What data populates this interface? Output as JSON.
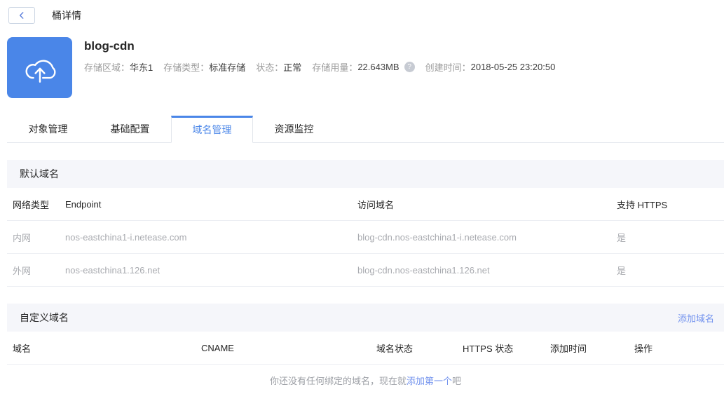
{
  "page": {
    "title": "桶详情"
  },
  "icons": {
    "help": "?"
  },
  "colors": {
    "accent": "#4a86e8",
    "link": "#7393ee",
    "icon_bg": "#4a86e8",
    "section_bar_bg": "#f5f6fa"
  },
  "bucket": {
    "name": "blog-cdn",
    "meta": [
      {
        "label": "存储区域：",
        "value": "华东1"
      },
      {
        "label": "存储类型：",
        "value": "标准存储"
      },
      {
        "label": "状态：",
        "value": "正常"
      },
      {
        "label": "存储用量：",
        "value": "22.643MB"
      },
      {
        "label": "创建时间：",
        "value": "2018-05-25 23:20:50"
      }
    ]
  },
  "tabs": [
    {
      "label": "对象管理",
      "active": false
    },
    {
      "label": "基础配置",
      "active": false
    },
    {
      "label": "域名管理",
      "active": true
    },
    {
      "label": "资源监控",
      "active": false
    }
  ],
  "sections": {
    "default": {
      "title": "默认域名",
      "columns": [
        "网络类型",
        "Endpoint",
        "访问域名",
        "支持 HTTPS"
      ],
      "rows": [
        [
          "内网",
          "nos-eastchina1-i.netease.com",
          "blog-cdn.nos-eastchina1-i.netease.com",
          "是"
        ],
        [
          "外网",
          "nos-eastchina1.126.net",
          "blog-cdn.nos-eastchina1.126.net",
          "是"
        ]
      ]
    },
    "custom": {
      "title": "自定义域名",
      "add_link": "添加域名",
      "columns": [
        "域名",
        "CNAME",
        "域名状态",
        "HTTPS 状态",
        "添加时间",
        "操作"
      ],
      "empty": {
        "prefix": "你还没有任何绑定的域名，现在就",
        "link": "添加第一个",
        "suffix": "吧"
      }
    }
  }
}
